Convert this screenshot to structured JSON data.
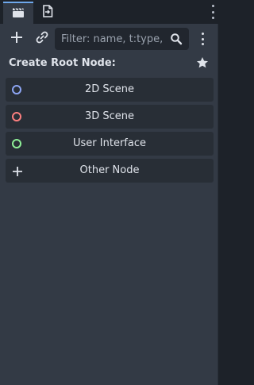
{
  "tabs": [
    {
      "icon": "scene-clapper-icon",
      "active": true
    },
    {
      "icon": "import-file-icon",
      "active": false
    }
  ],
  "toolbar": {
    "add_icon": "plus-icon",
    "link_icon": "link-icon",
    "search": {
      "placeholder": "Filter: name, t:type, g:group",
      "value": "",
      "icon": "search-icon"
    },
    "more_icon": "kebab-menu-icon"
  },
  "create_root": {
    "title": "Create Root Node:",
    "favorites_icon": "star-icon",
    "buttons": [
      {
        "label": "2D Scene",
        "icon": "node-2d-icon",
        "color": "#8da5f3"
      },
      {
        "label": "3D Scene",
        "icon": "node-3d-icon",
        "color": "#fc7f7f"
      },
      {
        "label": "User Interface",
        "icon": "control-node-icon",
        "color": "#8eef97"
      },
      {
        "label": "Other Node",
        "icon": "plus-icon",
        "color": "#dfe3ea"
      }
    ]
  },
  "colors": {
    "accent": "#6ea8ec",
    "panel_bg": "#333a45",
    "button_bg": "#282e36",
    "text": "#dfe3ea"
  }
}
